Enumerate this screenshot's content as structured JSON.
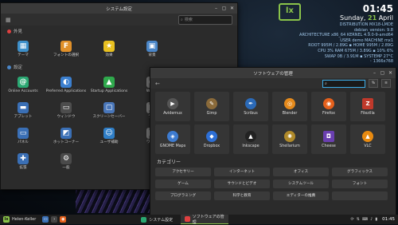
{
  "conky": {
    "logo": "lx",
    "time": "01:45",
    "date_day": "Sunday,",
    "date_num": "21",
    "date_month": "April",
    "lines": [
      "DISTRIBUTION MX18-LMDE",
      "debian_version: 9.8",
      "ARCHITECTURE x86_64 KERNEL 4.9.0-9-amd64",
      "USER demo MACHINE mx1",
      "ROOT 995M / 2.89G ▪ HOME 995M / 2.89G",
      "CPU 3% RAM 675M / 3.89G ▪ 10% 6%",
      "SWAP 0B / 3.91M ▪ SYSTEMP 27°C",
      "◦ 1366x768"
    ]
  },
  "settings": {
    "title": "システム設定",
    "search_placeholder": "検索",
    "section1": "外見",
    "section2": "設定",
    "row1": [
      {
        "label": "テーマ",
        "icon": "theme-icon",
        "color": "#3d8fc9",
        "glyph": "▦"
      },
      {
        "label": "フォントの選択",
        "icon": "font-icon",
        "color": "#e0902a",
        "glyph": "F"
      },
      {
        "label": "効果",
        "icon": "effects-icon",
        "color": "#e8c020",
        "glyph": "★"
      },
      {
        "label": "背景",
        "icon": "background-icon",
        "color": "#4a86c8",
        "glyph": "▣"
      }
    ],
    "rows": [
      [
        {
          "label": "Online Accounts",
          "icon": "online-accounts-icon",
          "color": "#2aa772",
          "glyph": "@"
        },
        {
          "label": "Preferred Applications",
          "icon": "preferred-apps-icon",
          "color": "#3b7fcf",
          "glyph": "◐"
        },
        {
          "label": "Startup Applications",
          "icon": "startup-apps-icon",
          "color": "#2fa94c",
          "glyph": "▲"
        },
        {
          "label": "Windo",
          "icon": "windows-icon",
          "color": "#777",
          "glyph": "▭"
        }
      ],
      [
        {
          "label": "アプレット",
          "icon": "applets-icon",
          "color": "#3a6fb5",
          "glyph": "▬"
        },
        {
          "label": "ウィンドウ",
          "icon": "window-icon",
          "color": "#4d4d4d",
          "glyph": "▭"
        },
        {
          "label": "スクリーンセーバー",
          "icon": "screensaver-icon",
          "color": "#4976b9",
          "glyph": "▢"
        },
        {
          "label": "デス",
          "icon": "desklets-icon",
          "color": "#777",
          "glyph": "▤"
        }
      ],
      [
        {
          "label": "パネル",
          "icon": "panel-icon",
          "color": "#3a6fb5",
          "glyph": "▭"
        },
        {
          "label": "ホットコーナー",
          "icon": "hot-corners-icon",
          "color": "#3a6fb5",
          "glyph": "◩"
        },
        {
          "label": "ユーザ補助",
          "icon": "accessibility-icon",
          "color": "#2f7ec6",
          "glyph": "☺"
        },
        {
          "label": "ワーク",
          "icon": "workspaces-icon",
          "color": "#777",
          "glyph": "▦"
        }
      ],
      [
        {
          "label": "拡張",
          "icon": "extensions-icon",
          "color": "#3a6fb5",
          "glyph": "✚"
        },
        {
          "label": "一般",
          "icon": "general-icon",
          "color": "#4a4a4a",
          "glyph": "⚙"
        },
        {
          "label": "",
          "icon": "",
          "color": "",
          "glyph": ""
        },
        {
          "label": "",
          "icon": "",
          "color": "",
          "glyph": ""
        }
      ]
    ]
  },
  "software": {
    "title": "ソフトウェアの管理",
    "search_value": "",
    "btn1": "≡",
    "btn2": "%",
    "apps": [
      {
        "label": "Avidemux",
        "icon": "avidemux-icon",
        "color": "#555",
        "glyph": "▶"
      },
      {
        "label": "Gimp",
        "icon": "gimp-icon",
        "color": "#8a6a3a",
        "glyph": "✎"
      },
      {
        "label": "Scribus",
        "icon": "scribus-icon",
        "color": "#2b6ab8",
        "glyph": "✒"
      },
      {
        "label": "Blender",
        "icon": "blender-icon",
        "color": "#e58a1c",
        "glyph": "◎"
      },
      {
        "label": "Firefox",
        "icon": "firefox-icon",
        "color": "#e4601c",
        "glyph": "◉"
      },
      {
        "label": "Filezilla",
        "icon": "filezilla-icon",
        "color": "#c0392b",
        "glyph": "Z"
      },
      {
        "label": "GNOME Maps",
        "icon": "maps-icon",
        "color": "#3d7bd0",
        "glyph": "◈"
      },
      {
        "label": "Dropbox",
        "icon": "dropbox-icon",
        "color": "#2d6fd6",
        "glyph": "◆"
      },
      {
        "label": "Inkscape",
        "icon": "inkscape-icon",
        "color": "#222",
        "glyph": "▲"
      },
      {
        "label": "Shellarium",
        "icon": "shellarium-icon",
        "color": "#b08a2a",
        "glyph": "✺"
      },
      {
        "label": "Cheese",
        "icon": "cheese-icon",
        "color": "#6a3fb0",
        "glyph": "◘"
      },
      {
        "label": "VLC",
        "icon": "vlc-icon",
        "color": "#e88a10",
        "glyph": "▲"
      }
    ],
    "categories_title": "カテゴリー",
    "categories": [
      "アクセサリー",
      "インターネット",
      "オフィス",
      "グラフィックス",
      "ゲーム",
      "サウンドとビデオ",
      "システムツール",
      "フォント",
      "プログラミング",
      "科学と教育",
      "エディターの推薦",
      ""
    ]
  },
  "panel": {
    "menu_label": "Helen-Keller",
    "tasks": [
      "システム設定",
      "ソフトウェアの管理"
    ],
    "clock": "01:45"
  }
}
